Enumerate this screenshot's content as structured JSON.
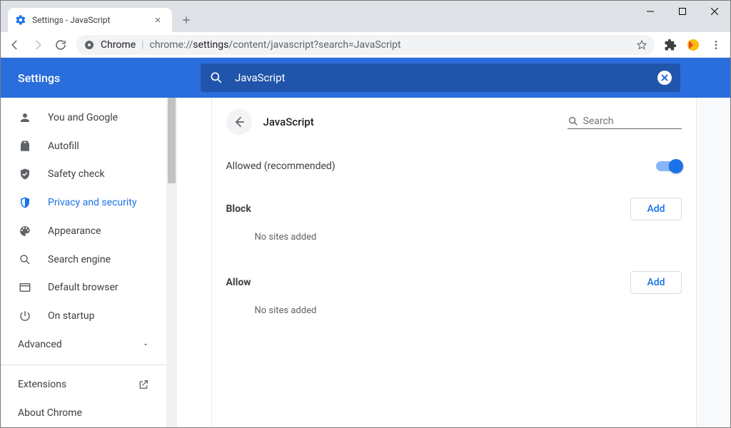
{
  "tab": {
    "title": "Settings - JavaScript"
  },
  "omnibox": {
    "origin": "Chrome",
    "url_prefix": "chrome://",
    "url_bold": "settings",
    "url_rest": "/content/javascript?search=JavaScript"
  },
  "header": {
    "title": "Settings",
    "search_value": "JavaScript"
  },
  "sidebar": {
    "items": [
      {
        "label": "You and Google"
      },
      {
        "label": "Autofill"
      },
      {
        "label": "Safety check"
      },
      {
        "label": "Privacy and security"
      },
      {
        "label": "Appearance"
      },
      {
        "label": "Search engine"
      },
      {
        "label": "Default browser"
      },
      {
        "label": "On startup"
      }
    ],
    "advanced": "Advanced",
    "extensions": "Extensions",
    "about": "About Chrome"
  },
  "page": {
    "title": "JavaScript",
    "search_placeholder": "Search",
    "allowed_label": "Allowed (recommended)",
    "block": {
      "title": "Block",
      "add": "Add",
      "empty": "No sites added"
    },
    "allow": {
      "title": "Allow",
      "add": "Add",
      "empty": "No sites added"
    }
  }
}
